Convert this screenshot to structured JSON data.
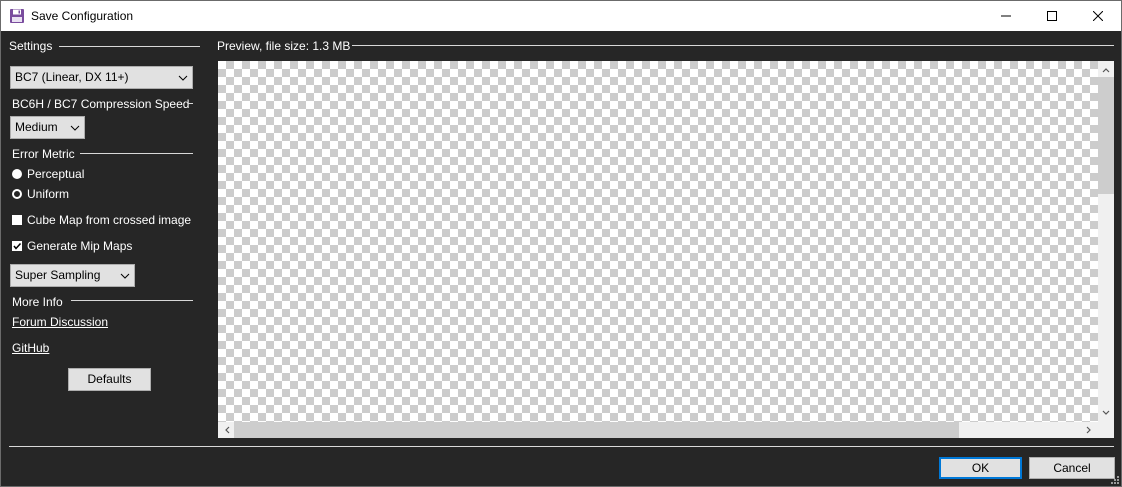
{
  "window": {
    "title": "Save Configuration",
    "icon": "floppy-disk-icon",
    "minimize_icon": "minimize-icon",
    "maximize_icon": "maximize-icon",
    "close_icon": "close-icon"
  },
  "settings": {
    "group_title": "Settings",
    "format_select": {
      "value": "BC7 (Linear, DX 11+)"
    },
    "speed_group_title": "BC6H / BC7 Compression Speed",
    "speed_select": {
      "value": "Medium"
    },
    "error_metric": {
      "title": "Error Metric",
      "options": [
        {
          "label": "Perceptual",
          "selected": true
        },
        {
          "label": "Uniform",
          "selected": false
        }
      ]
    },
    "cube_map": {
      "label": "Cube Map from crossed image",
      "checked": false
    },
    "mip_maps": {
      "label": "Generate Mip Maps",
      "checked": true
    },
    "sampling_select": {
      "value": "Super Sampling"
    },
    "more_info": {
      "title": "More Info",
      "links": [
        "Forum Discussion",
        "GitHub"
      ]
    },
    "defaults_button": "Defaults"
  },
  "preview": {
    "title": "Preview, file size: 1.3 MB"
  },
  "footer": {
    "ok_button": "OK",
    "cancel_button": "Cancel"
  }
}
